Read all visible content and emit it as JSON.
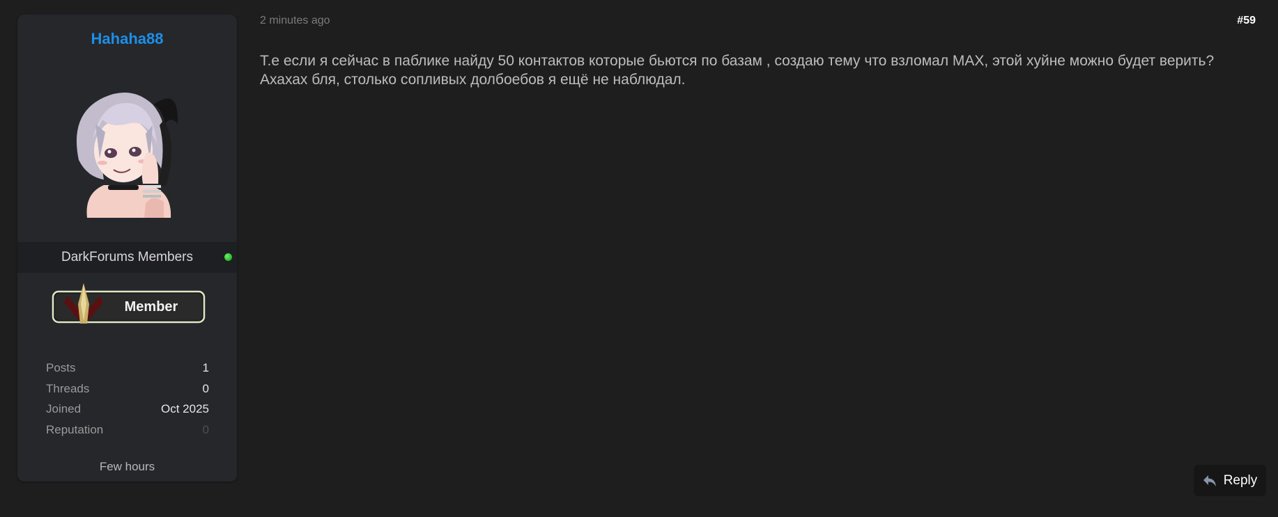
{
  "post": {
    "timestamp": "2 minutes ago",
    "number": "#59",
    "body": "Т.е если я сейчас в паблике найду 50 контактов которые бьются по базам , создаю тему что взломал MAX, этой хуйне можно будет верить? Ахахах бля, столько сопливых долбоебов я ещё не наблюдал."
  },
  "user": {
    "username": "Hahaha88",
    "username_color": "#1e8fe8",
    "group": "DarkForums Members",
    "online": true,
    "online_color": "#22b022",
    "rank_badge_text": "Member",
    "stats": [
      {
        "label": "Posts",
        "value": "1"
      },
      {
        "label": "Threads",
        "value": "0"
      },
      {
        "label": "Joined",
        "value": "Oct 2025"
      },
      {
        "label": "Reputation",
        "value": "0"
      }
    ],
    "last_active": "Few hours"
  },
  "actions": {
    "reply_label": "Reply",
    "reply_icon": "reply-arrow-icon"
  }
}
